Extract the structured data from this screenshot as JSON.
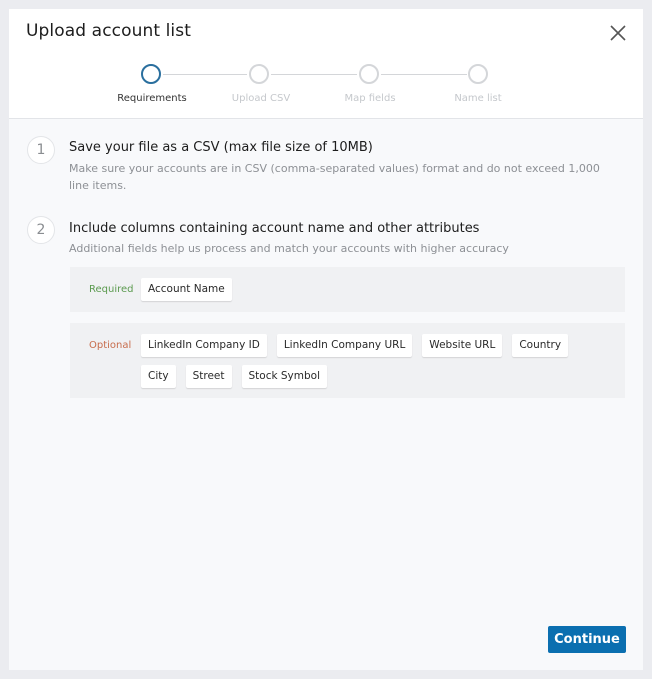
{
  "dialog": {
    "title": "Upload account list",
    "close_icon": "close-icon"
  },
  "stepper": {
    "current_step": 1,
    "steps": [
      {
        "label": "Requirements",
        "state": "active"
      },
      {
        "label": "Upload CSV",
        "state": "inactive"
      },
      {
        "label": "Map fields",
        "state": "inactive"
      },
      {
        "label": "Name list",
        "state": "inactive"
      }
    ]
  },
  "sections": [
    {
      "number": "1",
      "title": "Save your file as a CSV (max file size of 10MB)",
      "description": "Make sure your accounts are in CSV (comma-separated values) format and do not exceed 1,000 line items."
    },
    {
      "number": "2",
      "title": "Include columns containing account name and other attributes",
      "description": "Additional fields help us process and match your accounts with higher accuracy"
    }
  ],
  "fields": {
    "required": {
      "label": "Required",
      "color": "#5b9a4f",
      "items": [
        "Account Name"
      ]
    },
    "optional": {
      "label": "Optional",
      "color": "#c76d4d",
      "items": [
        "LinkedIn Company ID",
        "LinkedIn Company URL",
        "Website URL",
        "Country",
        "City",
        "Street",
        "Stock Symbol"
      ]
    }
  },
  "footer": {
    "continue_label": "Continue",
    "accent": "#0b6fb0"
  }
}
